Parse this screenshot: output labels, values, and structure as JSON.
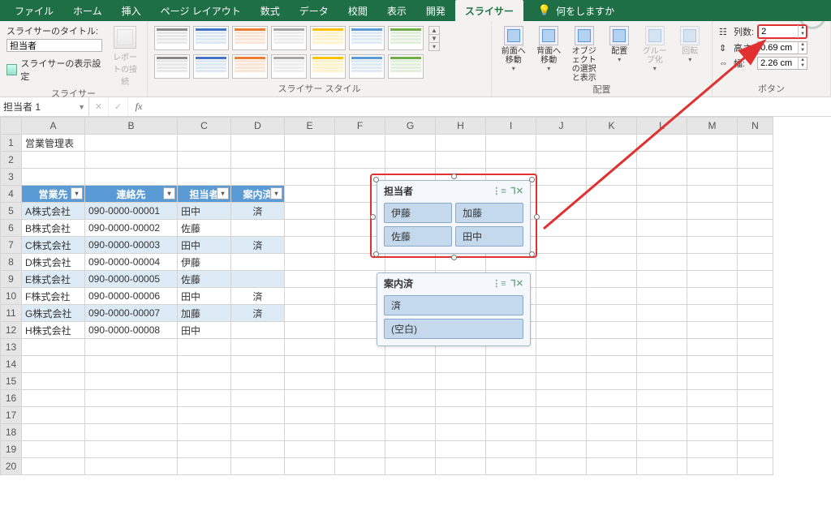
{
  "tabs": {
    "file": "ファイル",
    "home": "ホーム",
    "insert": "挿入",
    "layout": "ページ レイアウト",
    "formulas": "数式",
    "data": "データ",
    "review": "校閲",
    "view": "表示",
    "dev": "開発",
    "slicer": "スライサー"
  },
  "help_prompt": "何をしますか",
  "ribbon": {
    "caption_group": {
      "title_label": "スライサーのタイトル:",
      "title_value": "担当者",
      "settings_label": "スライサーの表示設定",
      "report_label": "レポートの接続",
      "group_name": "スライサー"
    },
    "styles_group": {
      "group_name": "スライサー スタイル"
    },
    "arrange_group": {
      "front": "前面へ移動",
      "back": "背面へ移動",
      "select": "オブジェクトの選択と表示",
      "align": "配置",
      "group": "グループ化",
      "rotate": "回転",
      "group_name": "配置"
    },
    "buttons_group": {
      "columns_label": "列数:",
      "columns_value": "2",
      "height_label": "高さ:",
      "height_value": "0.69 cm",
      "width_label": "幅:",
      "width_value": "2.26 cm",
      "group_name": "ボタン"
    }
  },
  "namebox": "担当者 1",
  "sheet": {
    "title_a1": "営業管理表",
    "columns": [
      "A",
      "B",
      "C",
      "D",
      "E",
      "F",
      "G",
      "H",
      "I",
      "J",
      "K",
      "L",
      "M",
      "N"
    ],
    "headers": {
      "a": "営業先",
      "b": "連絡先",
      "c": "担当者",
      "d": "案内済"
    },
    "rows": [
      {
        "a": "A株式会社",
        "b": "090-0000-00001",
        "c": "田中",
        "d": "済"
      },
      {
        "a": "B株式会社",
        "b": "090-0000-00002",
        "c": "佐藤",
        "d": ""
      },
      {
        "a": "C株式会社",
        "b": "090-0000-00003",
        "c": "田中",
        "d": "済"
      },
      {
        "a": "D株式会社",
        "b": "090-0000-00004",
        "c": "伊藤",
        "d": ""
      },
      {
        "a": "E株式会社",
        "b": "090-0000-00005",
        "c": "佐藤",
        "d": ""
      },
      {
        "a": "F株式会社",
        "b": "090-0000-00006",
        "c": "田中",
        "d": "済"
      },
      {
        "a": "G株式会社",
        "b": "090-0000-00007",
        "c": "加藤",
        "d": "済"
      },
      {
        "a": "H株式会社",
        "b": "090-0000-00008",
        "c": "田中",
        "d": ""
      }
    ]
  },
  "slicer1": {
    "title": "担当者",
    "items": [
      "伊藤",
      "加藤",
      "佐藤",
      "田中"
    ]
  },
  "slicer2": {
    "title": "案内済",
    "items": [
      "済",
      "(空白)"
    ]
  }
}
